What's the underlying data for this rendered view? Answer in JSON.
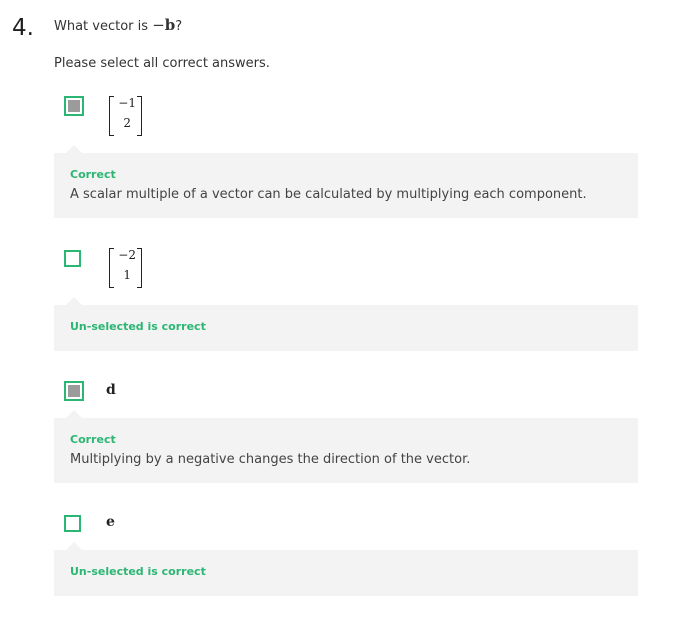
{
  "question": {
    "number": "4.",
    "text_prefix": "What vector is ",
    "text_math": "−",
    "text_math_bold": "b",
    "text_suffix": "?",
    "instruction": "Please select all correct answers."
  },
  "options": [
    {
      "type": "matrix",
      "row1": "−1",
      "row2": "2",
      "checked": true,
      "feedback_title": "Correct",
      "feedback_text": "A scalar multiple of a vector can be calculated by multiplying each component."
    },
    {
      "type": "matrix",
      "row1": "−2",
      "row2": "1",
      "checked": false,
      "feedback_title": "Un-selected is correct",
      "feedback_text": ""
    },
    {
      "type": "vector",
      "label": "d",
      "checked": true,
      "feedback_title": "Correct",
      "feedback_text": "Multiplying by a negative changes the direction of the vector."
    },
    {
      "type": "vector",
      "label": "e",
      "checked": false,
      "feedback_title": "Un-selected is correct",
      "feedback_text": ""
    }
  ],
  "colors": {
    "accent": "#2bb673",
    "feedback_bg": "#f3f3f3",
    "check_fill": "#9b9b9b"
  }
}
